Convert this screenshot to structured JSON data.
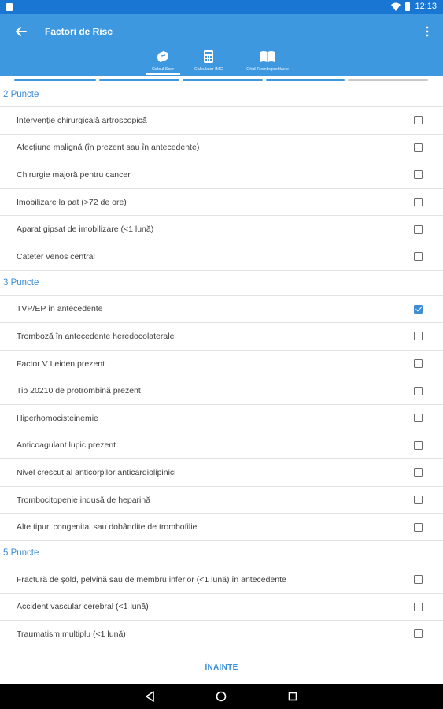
{
  "status_bar": {
    "time": "12:13"
  },
  "app_bar": {
    "title": "Factori de Risc",
    "back_icon": "arrow-left-icon",
    "menu_icon": "more-vert-icon"
  },
  "tabs": [
    {
      "label": "Calcul Scor",
      "icon": "clipboard-icon",
      "active": true
    },
    {
      "label": "Calculator IMC",
      "icon": "calculator-icon",
      "active": false
    },
    {
      "label": "Ghid Tromboprofilaxie",
      "icon": "book-icon",
      "active": false
    }
  ],
  "progress": {
    "steps_total": 5,
    "steps_completed": 4,
    "active_color": "#3d98e0",
    "inactive_color": "#c9c9c9"
  },
  "sections": [
    {
      "heading": "2 Puncte",
      "items": [
        {
          "label": "Intervenție chirurgicală artroscopică",
          "checked": false
        },
        {
          "label": "Afecțiune malignă (în prezent sau în antecedente)",
          "checked": false
        },
        {
          "label": "Chirurgie majoră pentru cancer",
          "checked": false
        },
        {
          "label": "Imobilizare la pat (>72 de ore)",
          "checked": false
        },
        {
          "label": "Aparat gipsat de imobilizare (<1 lună)",
          "checked": false
        },
        {
          "label": "Cateter venos central",
          "checked": false
        }
      ]
    },
    {
      "heading": "3 Puncte",
      "items": [
        {
          "label": "TVP/EP în antecedente",
          "checked": true
        },
        {
          "label": "Tromboză în antecedente heredocolaterale",
          "checked": false
        },
        {
          "label": "Factor V Leiden prezent",
          "checked": false
        },
        {
          "label": "Tip 20210 de protrombină prezent",
          "checked": false
        },
        {
          "label": "Hiperhomocisteinemie",
          "checked": false
        },
        {
          "label": "Anticoagulant lupic prezent",
          "checked": false
        },
        {
          "label": "Nivel crescut al anticorpilor anticardiolipinici",
          "checked": false
        },
        {
          "label": "Trombocitopenie indusă de heparină",
          "checked": false
        },
        {
          "label": "Alte tipuri congenital sau dobândite de trombofilie",
          "checked": false
        }
      ]
    },
    {
      "heading": "5 Puncte",
      "items": [
        {
          "label": "Fractură de șold, pelvină sau de membru inferior (<1 lună) în antecedente",
          "checked": false
        },
        {
          "label": "Accident vascular cerebral (<1 lună)",
          "checked": false
        },
        {
          "label": "Traumatism multiplu (<1 lună)",
          "checked": false
        }
      ]
    }
  ],
  "footer": {
    "next_label": "ÎNAINTE"
  },
  "nav_bar": {
    "back_icon": "nav-back-icon",
    "home_icon": "nav-home-icon",
    "recents_icon": "nav-recents-icon"
  }
}
